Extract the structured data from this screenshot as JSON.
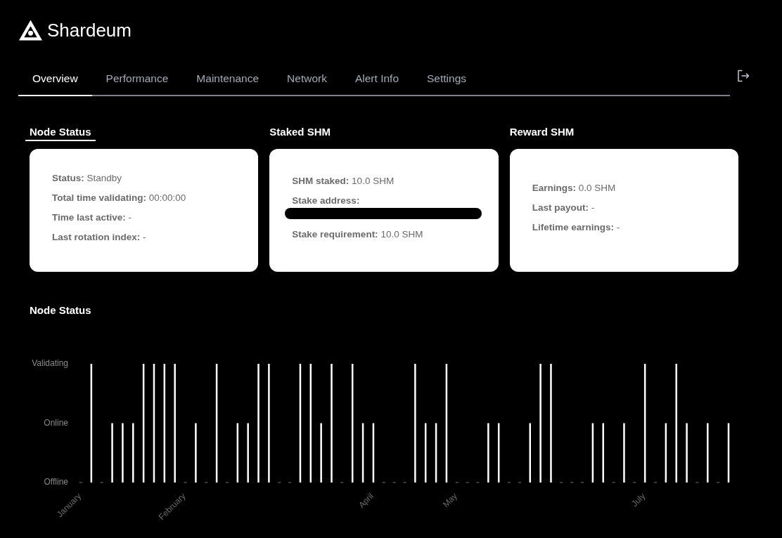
{
  "brand": {
    "name": "Shardeum"
  },
  "tabs": [
    {
      "label": "Overview",
      "selected": true
    },
    {
      "label": "Performance",
      "selected": false
    },
    {
      "label": "Maintenance",
      "selected": false
    },
    {
      "label": "Network",
      "selected": false
    },
    {
      "label": "Alert Info",
      "selected": false
    },
    {
      "label": "Settings",
      "selected": false
    }
  ],
  "cards": [
    {
      "title": "Node Status",
      "underlined": true,
      "items": [
        {
          "kind": "line",
          "text": "**Status:** Standby"
        },
        {
          "kind": "line",
          "text": "**Total time validating:** 00:00:00"
        },
        {
          "kind": "line",
          "text": "**Time last active:** -"
        },
        {
          "kind": "line",
          "text": "**Last rotation index:** -"
        }
      ]
    },
    {
      "title": "Staked SHM",
      "underlined": false,
      "items": [
        {
          "kind": "line",
          "text": "**SHM staked:** 10.0 SHM"
        },
        {
          "kind": "redacted",
          "label": "Stake address:"
        },
        {
          "kind": "line",
          "text": "**Stake requirement:** 10.0 SHM"
        }
      ]
    },
    {
      "title": "Reward SHM",
      "underlined": false,
      "items": [
        {
          "kind": "line",
          "text": "**Earnings:** 0.0 SHM"
        },
        {
          "kind": "line",
          "text": "**Last payout:** -"
        },
        {
          "kind": "line",
          "text": "**Lifetime earnings:** -"
        }
      ]
    }
  ],
  "status_chart": {
    "title": "Node Status",
    "y_axis_labels": [
      "Validating",
      "Online",
      "Offline"
    ],
    "bars": [
      {
        "kind": "offline",
        "axis_label": "January"
      },
      {
        "kind": "validating"
      },
      {
        "kind": "offline"
      },
      {
        "kind": "online"
      },
      {
        "kind": "online"
      },
      {
        "kind": "online"
      },
      {
        "kind": "validating"
      },
      {
        "kind": "validating"
      },
      {
        "kind": "validating"
      },
      {
        "kind": "validating"
      },
      {
        "kind": "offline",
        "axis_label": "February"
      },
      {
        "kind": "online"
      },
      {
        "kind": "offline"
      },
      {
        "kind": "validating"
      },
      {
        "kind": "offline"
      },
      {
        "kind": "online"
      },
      {
        "kind": "online"
      },
      {
        "kind": "validating"
      },
      {
        "kind": "validating"
      },
      {
        "kind": "offline"
      },
      {
        "kind": "offline"
      },
      {
        "kind": "validating"
      },
      {
        "kind": "validating"
      },
      {
        "kind": "online"
      },
      {
        "kind": "validating"
      },
      {
        "kind": "offline"
      },
      {
        "kind": "validating"
      },
      {
        "kind": "online"
      },
      {
        "kind": "online",
        "axis_label": "April"
      },
      {
        "kind": "offline"
      },
      {
        "kind": "offline"
      },
      {
        "kind": "offline"
      },
      {
        "kind": "validating"
      },
      {
        "kind": "online"
      },
      {
        "kind": "online"
      },
      {
        "kind": "validating"
      },
      {
        "kind": "offline",
        "axis_label": "May"
      },
      {
        "kind": "offline"
      },
      {
        "kind": "offline"
      },
      {
        "kind": "online"
      },
      {
        "kind": "online"
      },
      {
        "kind": "offline"
      },
      {
        "kind": "offline"
      },
      {
        "kind": "online"
      },
      {
        "kind": "validating"
      },
      {
        "kind": "validating"
      },
      {
        "kind": "offline"
      },
      {
        "kind": "offline"
      },
      {
        "kind": "offline"
      },
      {
        "kind": "online"
      },
      {
        "kind": "online"
      },
      {
        "kind": "offline"
      },
      {
        "kind": "online"
      },
      {
        "kind": "offline"
      },
      {
        "kind": "validating",
        "axis_label": "July"
      },
      {
        "kind": "offline"
      },
      {
        "kind": "online"
      },
      {
        "kind": "validating"
      },
      {
        "kind": "online"
      },
      {
        "kind": "offline"
      },
      {
        "kind": "online"
      },
      {
        "kind": "offline"
      },
      {
        "kind": "online"
      }
    ]
  }
}
